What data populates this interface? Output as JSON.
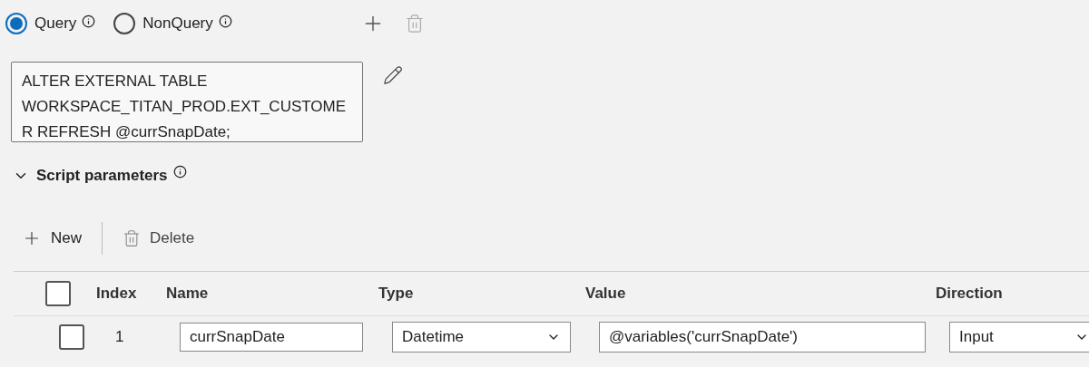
{
  "query_type": [
    {
      "label": "Query",
      "selected": true
    },
    {
      "label": "NonQuery",
      "selected": false
    }
  ],
  "script": {
    "lines": [
      "ALTER EXTERNAL TABLE",
      "WORKSPACE_TITAN_PROD.EXT_CUSTOME",
      "R REFRESH @currSnapDate;"
    ]
  },
  "section": {
    "title": "Script parameters",
    "expanded": true
  },
  "toolbar": [
    "New",
    "Delete"
  ],
  "table": {
    "all_checked": false,
    "columns": [
      "Index",
      "Name",
      "Type",
      "Value",
      "Direction"
    ],
    "rows": [
      {
        "checked": false,
        "index": "1",
        "name": "currSnapDate",
        "type": "Datetime",
        "value": "@variables('currSnapDate')",
        "direction": "Input"
      }
    ]
  }
}
